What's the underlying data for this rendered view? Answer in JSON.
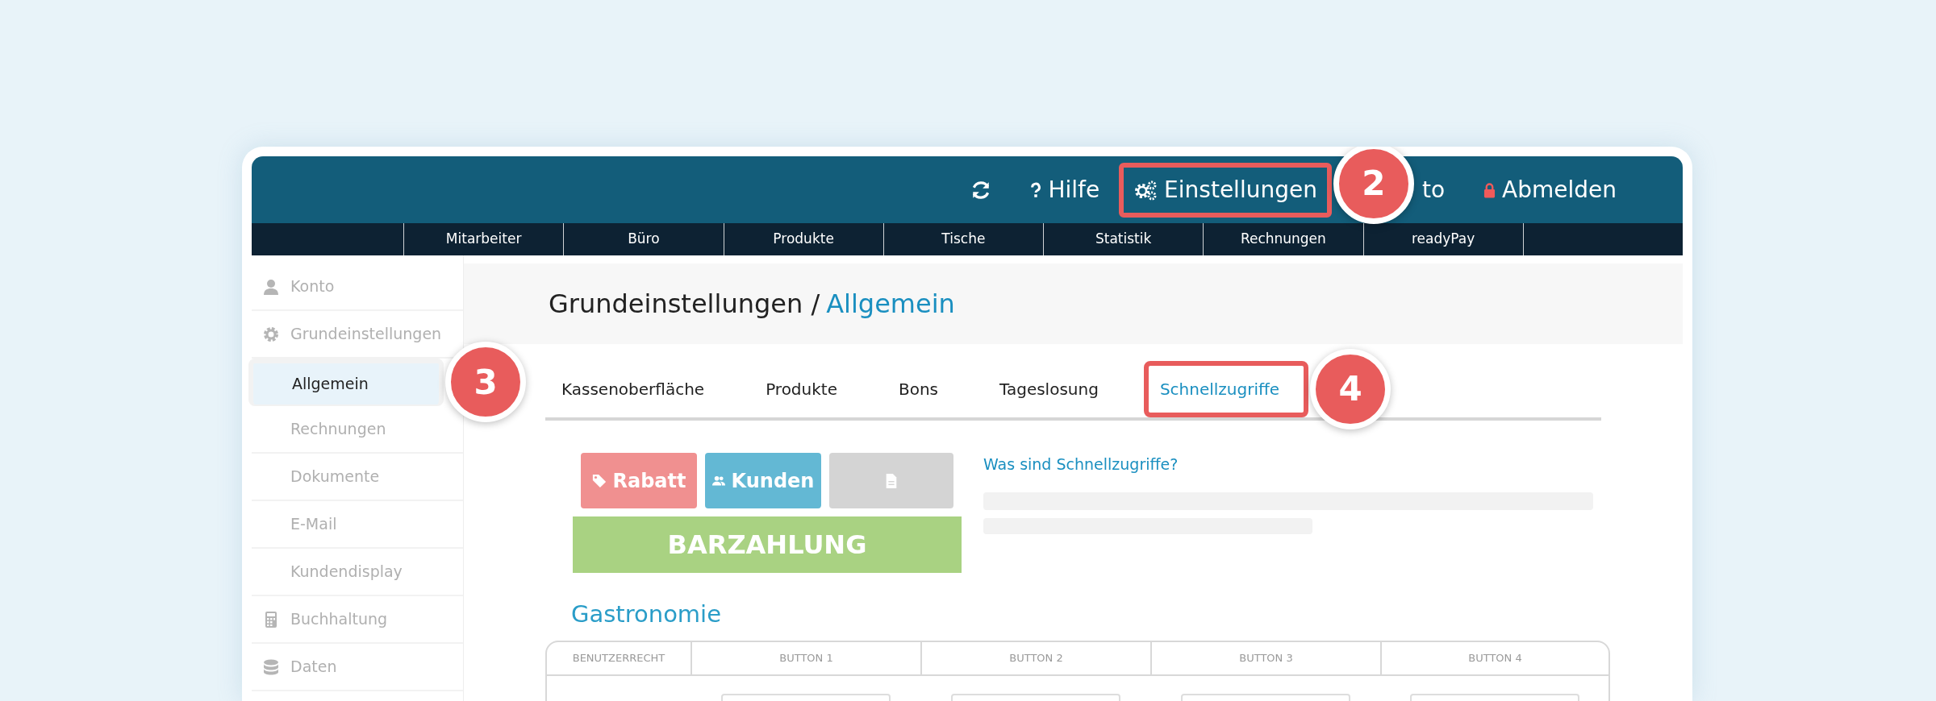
{
  "header": {
    "items": [
      {
        "kind": "refresh"
      },
      {
        "kind": "help",
        "label": "Hilfe"
      },
      {
        "kind": "settings",
        "label": "Einstellungen",
        "callout": "2"
      },
      {
        "kind": "account",
        "label": "to"
      },
      {
        "kind": "logout",
        "label": "Abmelden"
      }
    ]
  },
  "menu": [
    "Mitarbeiter",
    "Büro",
    "Produkte",
    "Tische",
    "Statistik",
    "Rechnungen",
    "readyPay"
  ],
  "sidebar": {
    "items": [
      {
        "kind": "account",
        "label": "Konto",
        "selected": false
      },
      {
        "kind": "settings",
        "label": "Grundeinstellungen",
        "selected": false,
        "children": [
          {
            "label": "Allgemein",
            "selected": true,
            "callout": "3"
          },
          {
            "label": "Rechnungen",
            "selected": false
          },
          {
            "label": "Dokumente",
            "selected": false
          },
          {
            "label": "E-Mail",
            "selected": false
          },
          {
            "label": "Kundendisplay",
            "selected": false
          }
        ]
      },
      {
        "kind": "accounting",
        "label": "Buchhaltung",
        "selected": false
      },
      {
        "kind": "data",
        "label": "Daten",
        "selected": false
      }
    ]
  },
  "page_title": {
    "parent": "Grundeinstellungen /",
    "current": "Allgemein"
  },
  "tabs": [
    {
      "label": "Kassenoberfläche",
      "selected": false
    },
    {
      "label": "Produkte",
      "selected": false
    },
    {
      "label": "Bons",
      "selected": false
    },
    {
      "label": "Tageslosung",
      "selected": false
    },
    {
      "label": "Schnellzugriffe",
      "selected": true,
      "callout": "4"
    }
  ],
  "preview": {
    "buttons": [
      {
        "kind": "discount",
        "label": "Rabatt",
        "color": "#f09090"
      },
      {
        "kind": "customers",
        "label": "Kunden",
        "color": "#63b8d4"
      },
      {
        "kind": "document",
        "color": "#d4d4d4"
      }
    ],
    "pay_button": "BARZAHLUNG"
  },
  "help_link": "Was sind Schnellzugriffe?",
  "section_title": "Gastronomie",
  "table": {
    "columns": [
      "BENUTZERRECHT",
      "BUTTON 1",
      "BUTTON 2",
      "BUTTON 3",
      "BUTTON 4"
    ]
  }
}
